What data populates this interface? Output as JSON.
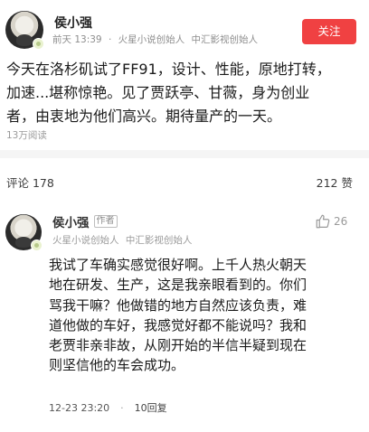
{
  "post": {
    "author": "侯小强",
    "meta": [
      "前天 13:39",
      "·",
      "火星小说创始人",
      "中汇影视创始人"
    ],
    "follow_label": "关注",
    "text_lines": [
      "今天在洛杉矶试了FF91，设计、性能，原地打转，",
      "加速...堪称惊艳。见了贾跃亭、甘薇，身为创业",
      "者，由衷地为他们高兴。期待量产的一天。"
    ],
    "read_count": "13万阅读"
  },
  "stats": {
    "comments": "评论 178",
    "likes": "212 赞"
  },
  "comment": {
    "author": "侯小强",
    "author_tag": "作者",
    "meta": [
      "火星小说创始人",
      "中汇影视创始人"
    ],
    "like_count": "26",
    "text_lines": [
      "我试了车确实感觉很好啊。上千人热火朝天",
      "地在研发、生产，这是我亲眼看到的。你们",
      "骂我干嘛？他做错的地方自然应该负责，难",
      "道他做的车好，我感觉好都不能说吗？我和",
      "老贾非亲非故，从刚开始的半信半疑到现在",
      "则坚信他的车会成功。"
    ],
    "time": "12-23 23:20",
    "separator": "·",
    "reply": "10回复"
  },
  "colors": {
    "follow_button": "#f04142",
    "divider": "#f5f5f5"
  },
  "icons": {
    "like": "thumbs-up-icon"
  }
}
